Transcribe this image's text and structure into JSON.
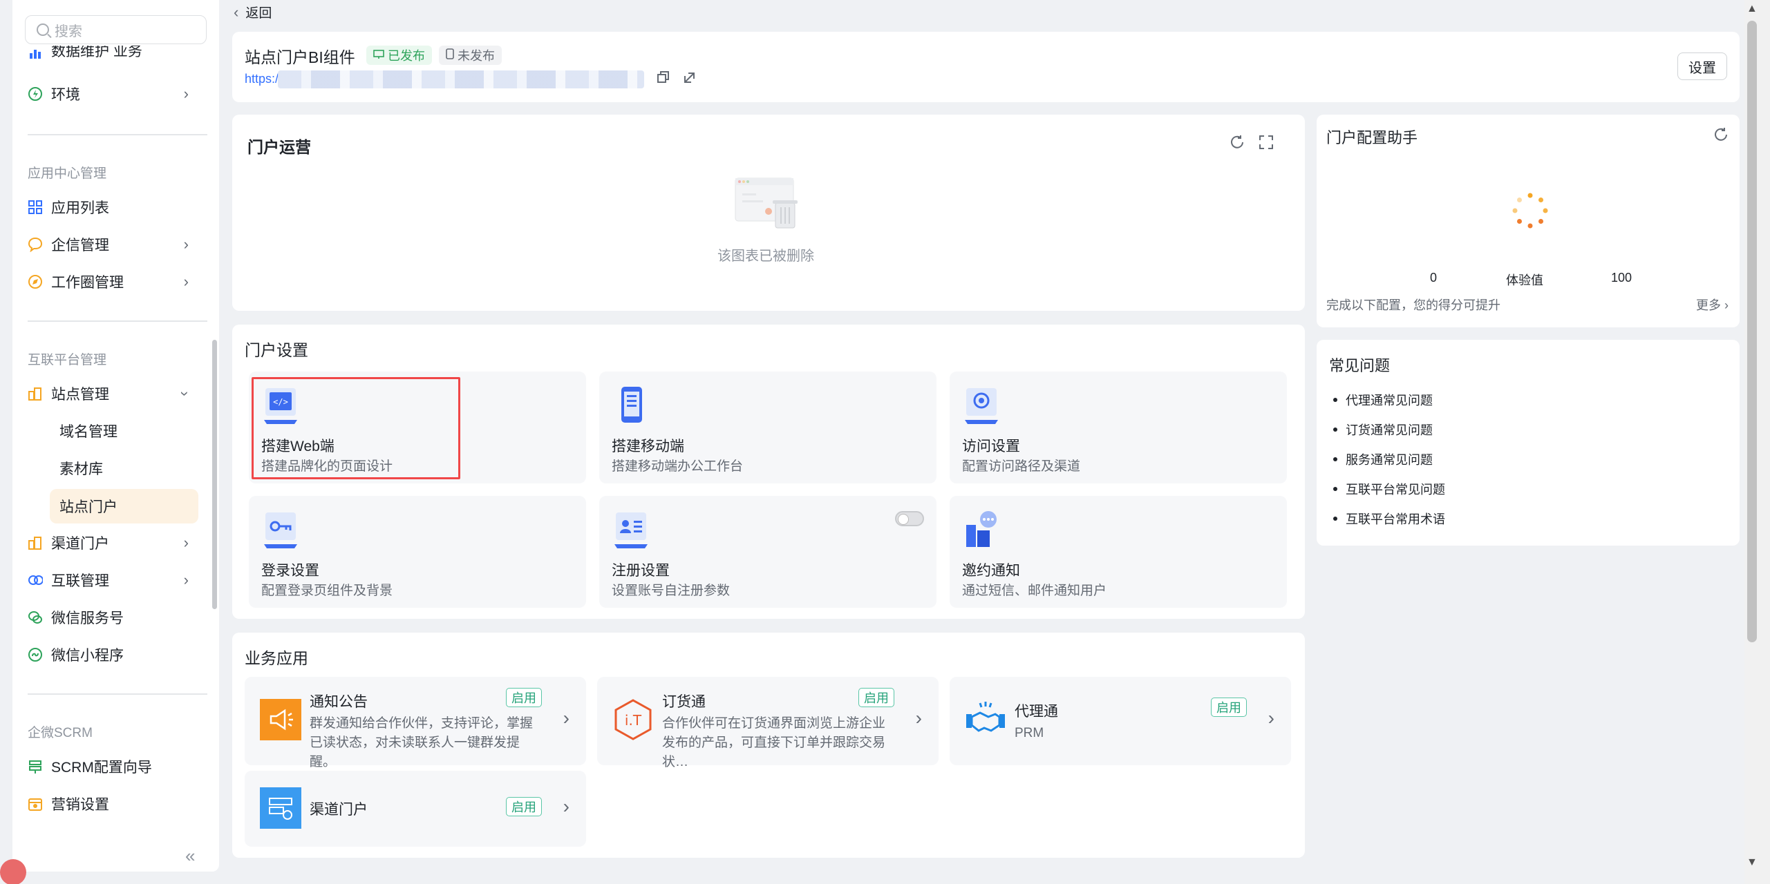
{
  "sidebar": {
    "search_placeholder": "搜索",
    "partial_item": "数据维护 业务",
    "env": "环境",
    "sec_app_center": "应用中心管理",
    "app_list": "应用列表",
    "qixin": "企信管理",
    "workcircle": "工作圈管理",
    "sec_internet": "互联平台管理",
    "site_mgmt": "站点管理",
    "domain": "域名管理",
    "material": "素材库",
    "site_portal": "站点门户",
    "channel_portal": "渠道门户",
    "interconnect": "互联管理",
    "wechat_service": "微信服务号",
    "wechat_mini": "微信小程序",
    "sec_scrm": "企微SCRM",
    "scrm_guide": "SCRM配置向导",
    "marketing": "营销设置",
    "collapse": "«"
  },
  "header": {
    "back": "返回",
    "title": "站点门户BI组件",
    "published": "已发布",
    "unpublished": "未发布",
    "url_prefix": "https:/",
    "settings": "设置"
  },
  "ops": {
    "title": "门户运营",
    "empty": "该图表已被删除"
  },
  "portal_settings": {
    "title": "门户设置",
    "tiles": [
      {
        "name": "搭建Web端",
        "desc": "搭建品牌化的页面设计"
      },
      {
        "name": "搭建移动端",
        "desc": "搭建移动端办公工作台"
      },
      {
        "name": "访问设置",
        "desc": "配置访问路径及渠道"
      },
      {
        "name": "登录设置",
        "desc": "配置登录页组件及背景"
      },
      {
        "name": "注册设置",
        "desc": "设置账号自注册参数"
      },
      {
        "name": "邀约通知",
        "desc": "通过短信、邮件通知用户"
      }
    ]
  },
  "business": {
    "title": "业务应用",
    "enabled": "启用",
    "tiles": [
      {
        "name": "通知公告",
        "desc": "群发通知给合作伙伴，支持评论，掌握已读状态，对未读联系人一键群发提醒。"
      },
      {
        "name": "订货通",
        "desc": "合作伙伴可在订货通界面浏览上游企业发布的产品，可直接下订单并跟踪交易状…"
      },
      {
        "name": "代理通",
        "desc": "PRM"
      },
      {
        "name": "渠道门户",
        "desc": ""
      }
    ]
  },
  "assistant": {
    "title": "门户配置助手",
    "min": "0",
    "label": "体验值",
    "max": "100",
    "footer": "完成以下配置，您的得分可提升",
    "more": "更多"
  },
  "faq": {
    "title": "常见问题",
    "items": [
      "代理通常见问题",
      "订货通常见问题",
      "服务通常见问题",
      "互联平台常见问题",
      "互联平台常用术语"
    ]
  },
  "colors": {
    "accent_orange": "#f5a623",
    "brand_blue": "#3370ff",
    "highlight_red": "#f04748",
    "enabled_green": "#26a37a"
  }
}
